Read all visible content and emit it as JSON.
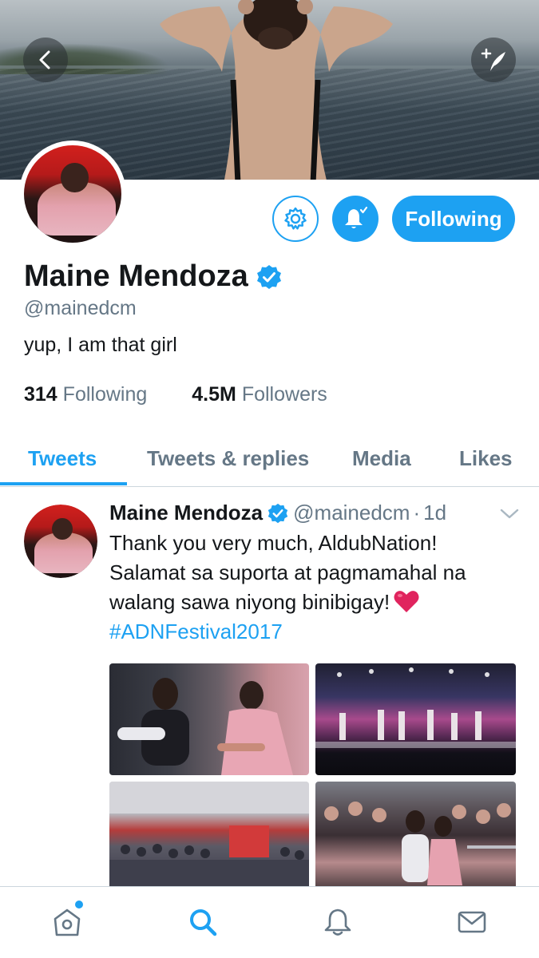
{
  "header": {
    "back_icon": "chevron-left-icon",
    "compose_icon": "compose-tweet-icon"
  },
  "profile": {
    "display_name": "Maine Mendoza",
    "handle": "@mainedcm",
    "bio": "yup, I am that girl",
    "verified": true,
    "following_count": "314",
    "following_label": "Following",
    "followers_count": "4.5M",
    "followers_label": "Followers"
  },
  "actions": {
    "settings_icon": "gear-icon",
    "notify_icon": "bell-check-icon",
    "follow_label": "Following"
  },
  "tabs": [
    {
      "label": "Tweets",
      "active": true
    },
    {
      "label": "Tweets & replies",
      "active": false
    },
    {
      "label": "Media",
      "active": false
    },
    {
      "label": "Likes",
      "active": false
    }
  ],
  "tweet": {
    "name": "Maine Mendoza",
    "handle": "@mainedcm",
    "separator": "·",
    "time": "1d",
    "lines": [
      "Thank you very much, AldubNation!",
      "Salamat sa suporta at pagmamahal na",
      "walang sawa niyong binibigay!"
    ],
    "emoji": "heart-emoji",
    "hashtag": "#ADNFestival2017",
    "media_count": 4
  },
  "bottom_nav": [
    {
      "icon": "home-icon",
      "active": false,
      "badge": true
    },
    {
      "icon": "search-icon",
      "active": true
    },
    {
      "icon": "bell-icon",
      "active": false
    },
    {
      "icon": "mail-icon",
      "active": false
    }
  ],
  "colors": {
    "accent": "#1da1f2",
    "text": "#14171a",
    "secondary_text": "#657786",
    "border": "#ccd6dd",
    "heart": "#e0245e"
  }
}
